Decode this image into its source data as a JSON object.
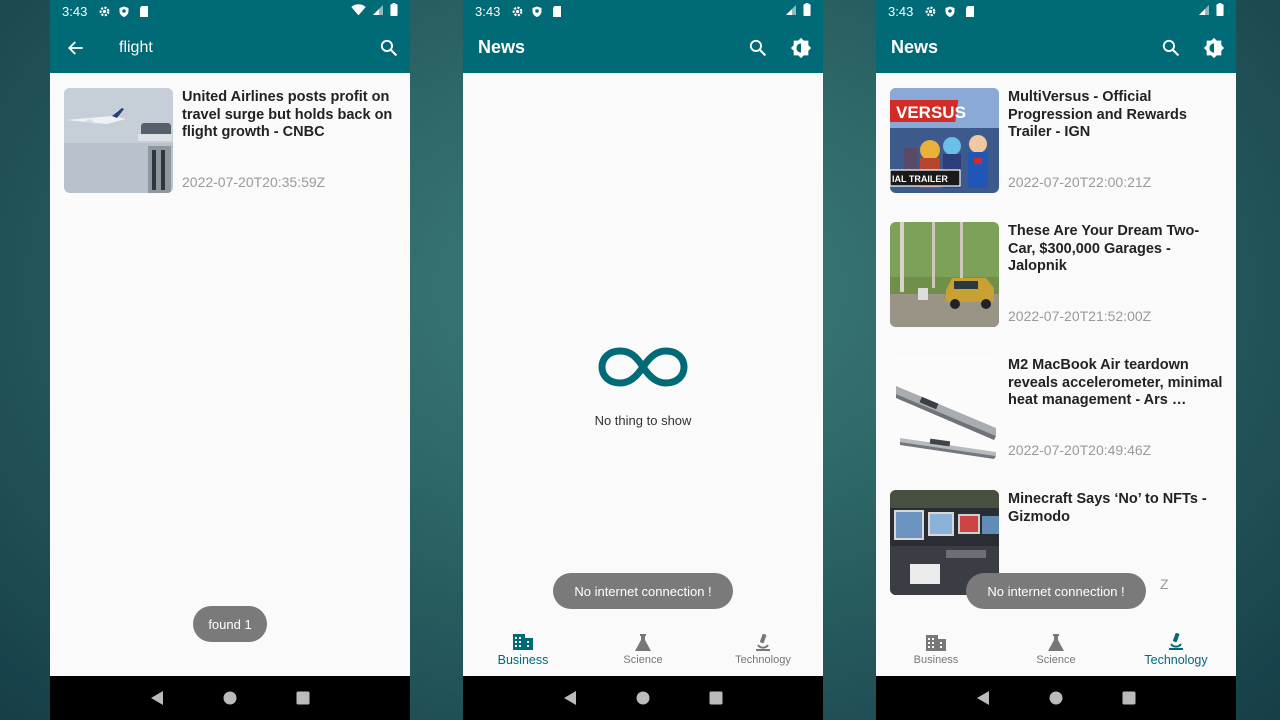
{
  "status": {
    "time": "3:43"
  },
  "screen1": {
    "search_query": "flight",
    "results": [
      {
        "headline": "United Airlines posts profit on travel surge but holds back on flight growth - CNBC",
        "date": "2022-07-20T20:35:59Z"
      }
    ],
    "toast": "found 1"
  },
  "screen2": {
    "title": "News",
    "empty_message": "No thing to show",
    "toast": "No internet connection !",
    "tabs": [
      {
        "label": "Business",
        "active": true
      },
      {
        "label": "Science"
      },
      {
        "label": "Technology"
      }
    ]
  },
  "screen3": {
    "title": "News",
    "articles": [
      {
        "headline": "MultiVersus - Official Progression and Rewards Trailer - IGN",
        "date": "2022-07-20T22:00:21Z",
        "thumb_text": "VERSUS",
        "thumb_caption": "IAL TRAILER"
      },
      {
        "headline": "These Are Your Dream Two-Car, $300,000 Garages - Jalopnik",
        "date": "2022-07-20T21:52:00Z"
      },
      {
        "headline": "M2 MacBook Air teardown reveals accelerometer, minimal heat management - Ars …",
        "date": "2022-07-20T20:49:46Z"
      },
      {
        "headline": "Minecraft Says ‘No’ to NFTs - Gizmodo",
        "date": "Z"
      }
    ],
    "toast": "No internet connection !",
    "tabs": [
      {
        "label": "Business"
      },
      {
        "label": "Science"
      },
      {
        "label": "Technology",
        "active": true
      }
    ]
  },
  "colors": {
    "primary": "#006a76",
    "toast": "#7a7a7a",
    "date": "#9a9a9a"
  }
}
